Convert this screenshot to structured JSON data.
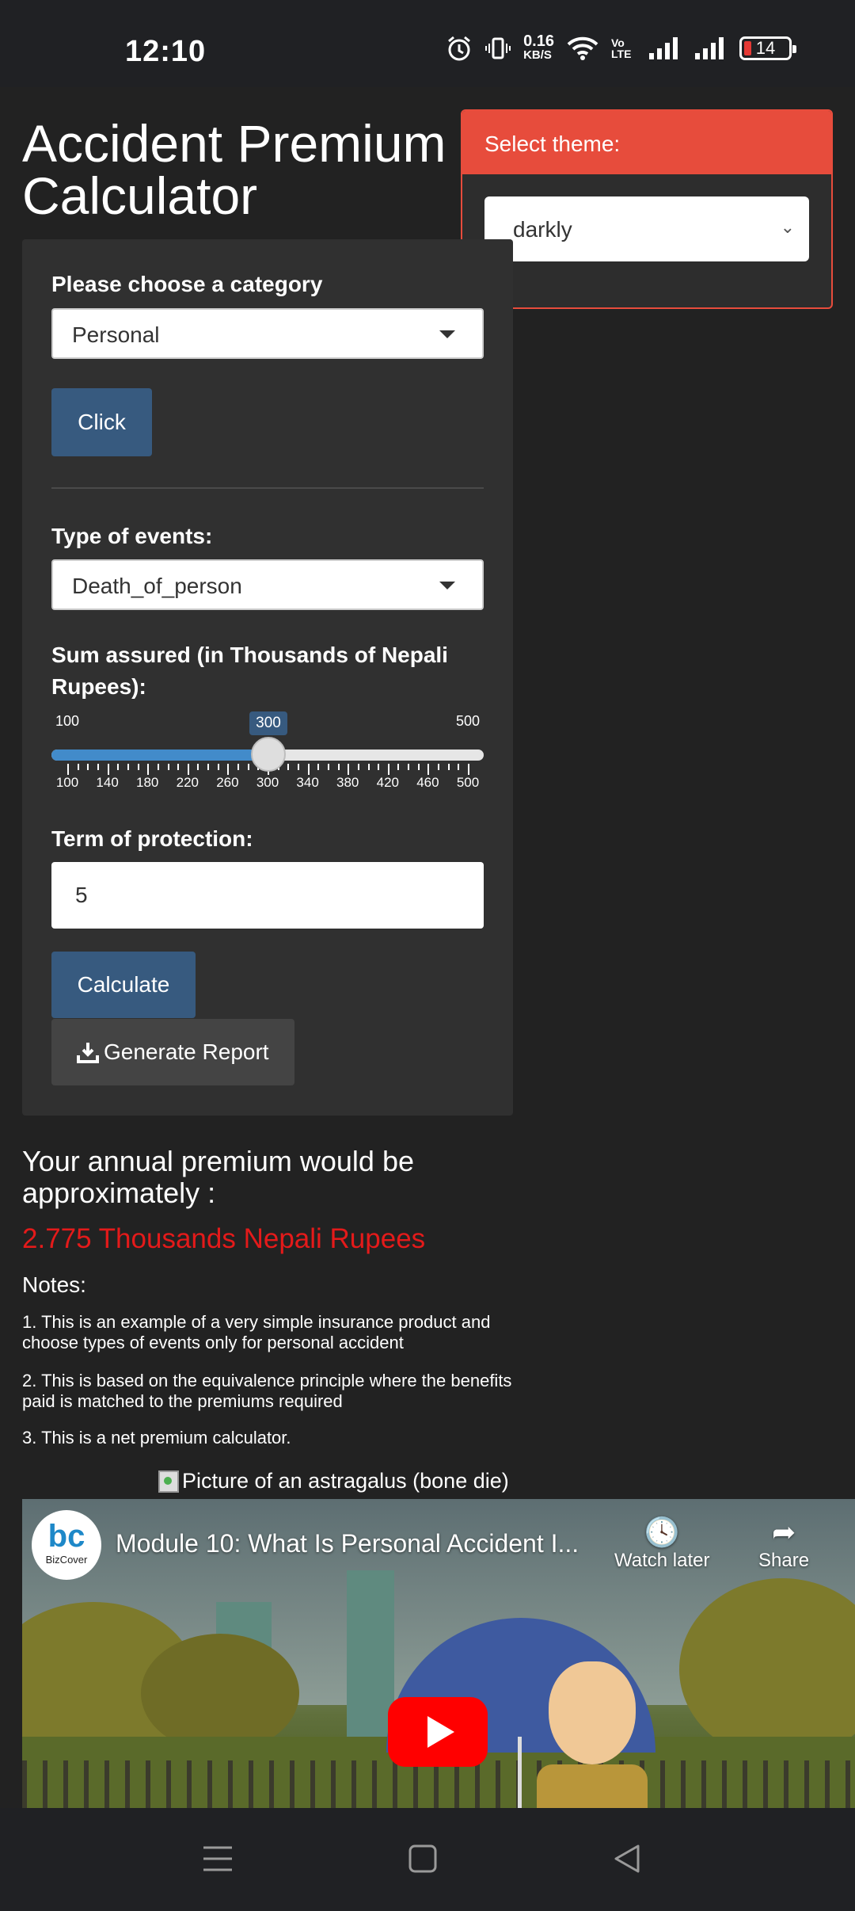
{
  "status_bar": {
    "time": "12:10",
    "net_speed_value": "0.16",
    "net_speed_unit": "KB/S",
    "volte": "Vo LTE",
    "battery": "14"
  },
  "app": {
    "title": "Accident Premium Calculator"
  },
  "theme": {
    "heading": "Select theme:",
    "selected": "darkly"
  },
  "form": {
    "category_label": "Please choose a category",
    "category_value": "Personal",
    "click_button": "Click",
    "events_label": "Type of events:",
    "events_value": "Death_of_person",
    "sum_label": "Sum assured (in Thousands of Nepali Rupees):",
    "slider": {
      "min": 100,
      "max": 500,
      "value": 300,
      "min_label": "100",
      "max_label": "500",
      "value_label": "300",
      "ticks": [
        "100",
        "140",
        "180",
        "220",
        "260",
        "300",
        "340",
        "380",
        "420",
        "460",
        "500"
      ]
    },
    "term_label": "Term of protection:",
    "term_value": "5",
    "calculate_button": "Calculate",
    "report_button": "Generate Report"
  },
  "result": {
    "heading": "Your annual premium would be approximately :",
    "value": "2.775 Thousands Nepali Rupees",
    "value_color": "#e41a1a"
  },
  "notes": {
    "heading": "Notes:",
    "items": [
      "1. This is an example of a very simple insurance product and choose types of events only for personal accident",
      "2. This is based on the equivalence principle where the benefits paid is matched to the premiums required",
      "3. This is a net premium calculator."
    ]
  },
  "image_alt": "Picture of an astragalus (bone die)",
  "video": {
    "channel_logo_text": "bc",
    "channel_name": "BizCover",
    "title": "Module 10: What Is Personal Accident I...",
    "watch_later": "Watch later",
    "share": "Share"
  },
  "colors": {
    "background": "#222222",
    "card": "#303030",
    "primary": "#375a7f",
    "danger": "#e74c3c"
  }
}
